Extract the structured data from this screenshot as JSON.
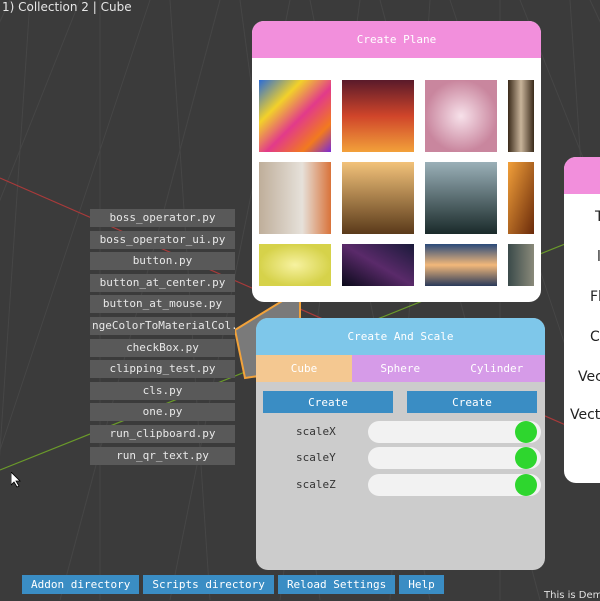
{
  "viewport": {
    "title": "1) Collection 2 | Cube"
  },
  "file_list": [
    "boss_operator.py",
    "boss_operator_ui.py",
    "button.py",
    "button_at_center.py",
    "button_at_mouse.py",
    "ngeColorToMaterialCol.",
    "checkBox.py",
    "clipping_test.py",
    "cls.py",
    "one.py",
    "run_clipboard.py",
    "run_qr_text.py"
  ],
  "create_plane": {
    "title": "Create Plane",
    "thumbnails": [
      "colorful-paint",
      "sunset-clouds",
      "pink-bokeh",
      "brick-texture",
      "white-dove",
      "misty-hills",
      "elephant-forest",
      "autumn-forest",
      "lemon-slices",
      "starry-sky",
      "sunset-lake",
      "rock-cliff"
    ]
  },
  "create_and_scale": {
    "title": "Create And Scale",
    "tabs": [
      "Cube",
      "Sphere",
      "Cylinder"
    ],
    "active_tab": "Cube",
    "create_buttons": [
      "Create",
      "Create"
    ],
    "sliders": [
      {
        "label": "scaleX"
      },
      {
        "label": "scaleY"
      },
      {
        "label": "scaleZ"
      }
    ]
  },
  "side_panel": {
    "labels": [
      "T",
      "l",
      "Fl",
      "C",
      "Vec",
      "Vect"
    ]
  },
  "bottom_bar": {
    "buttons": [
      "Addon directory",
      "Scripts directory",
      "Reload Settings",
      "Help"
    ],
    "note": "This is Dem"
  },
  "colors": {
    "pink_header": "#f28fdc",
    "blue_header": "#7ec7ea",
    "tab_active": "#f4c891",
    "tab_inactive": "#d69be8",
    "button_blue": "#3a8dc4",
    "knob_green": "#2ed62e"
  }
}
